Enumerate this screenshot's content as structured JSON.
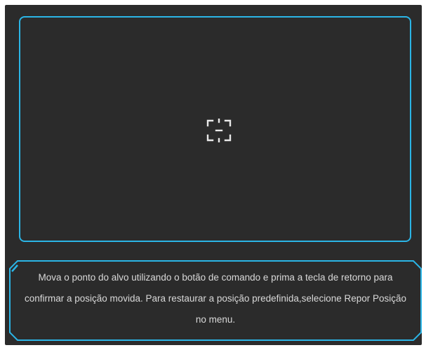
{
  "target_icon": "focus-crosshair-icon",
  "colors": {
    "background": "#2b2b2b",
    "frame_accent": "#2bb5e6",
    "text": "#d9d9d9"
  },
  "info": {
    "message": "Mova o ponto do alvo utilizando o botão de comando e prima a tecla de retorno para confirmar a posição movida. Para restaurar a posição predefinida,selecione Repor Posição no menu."
  }
}
